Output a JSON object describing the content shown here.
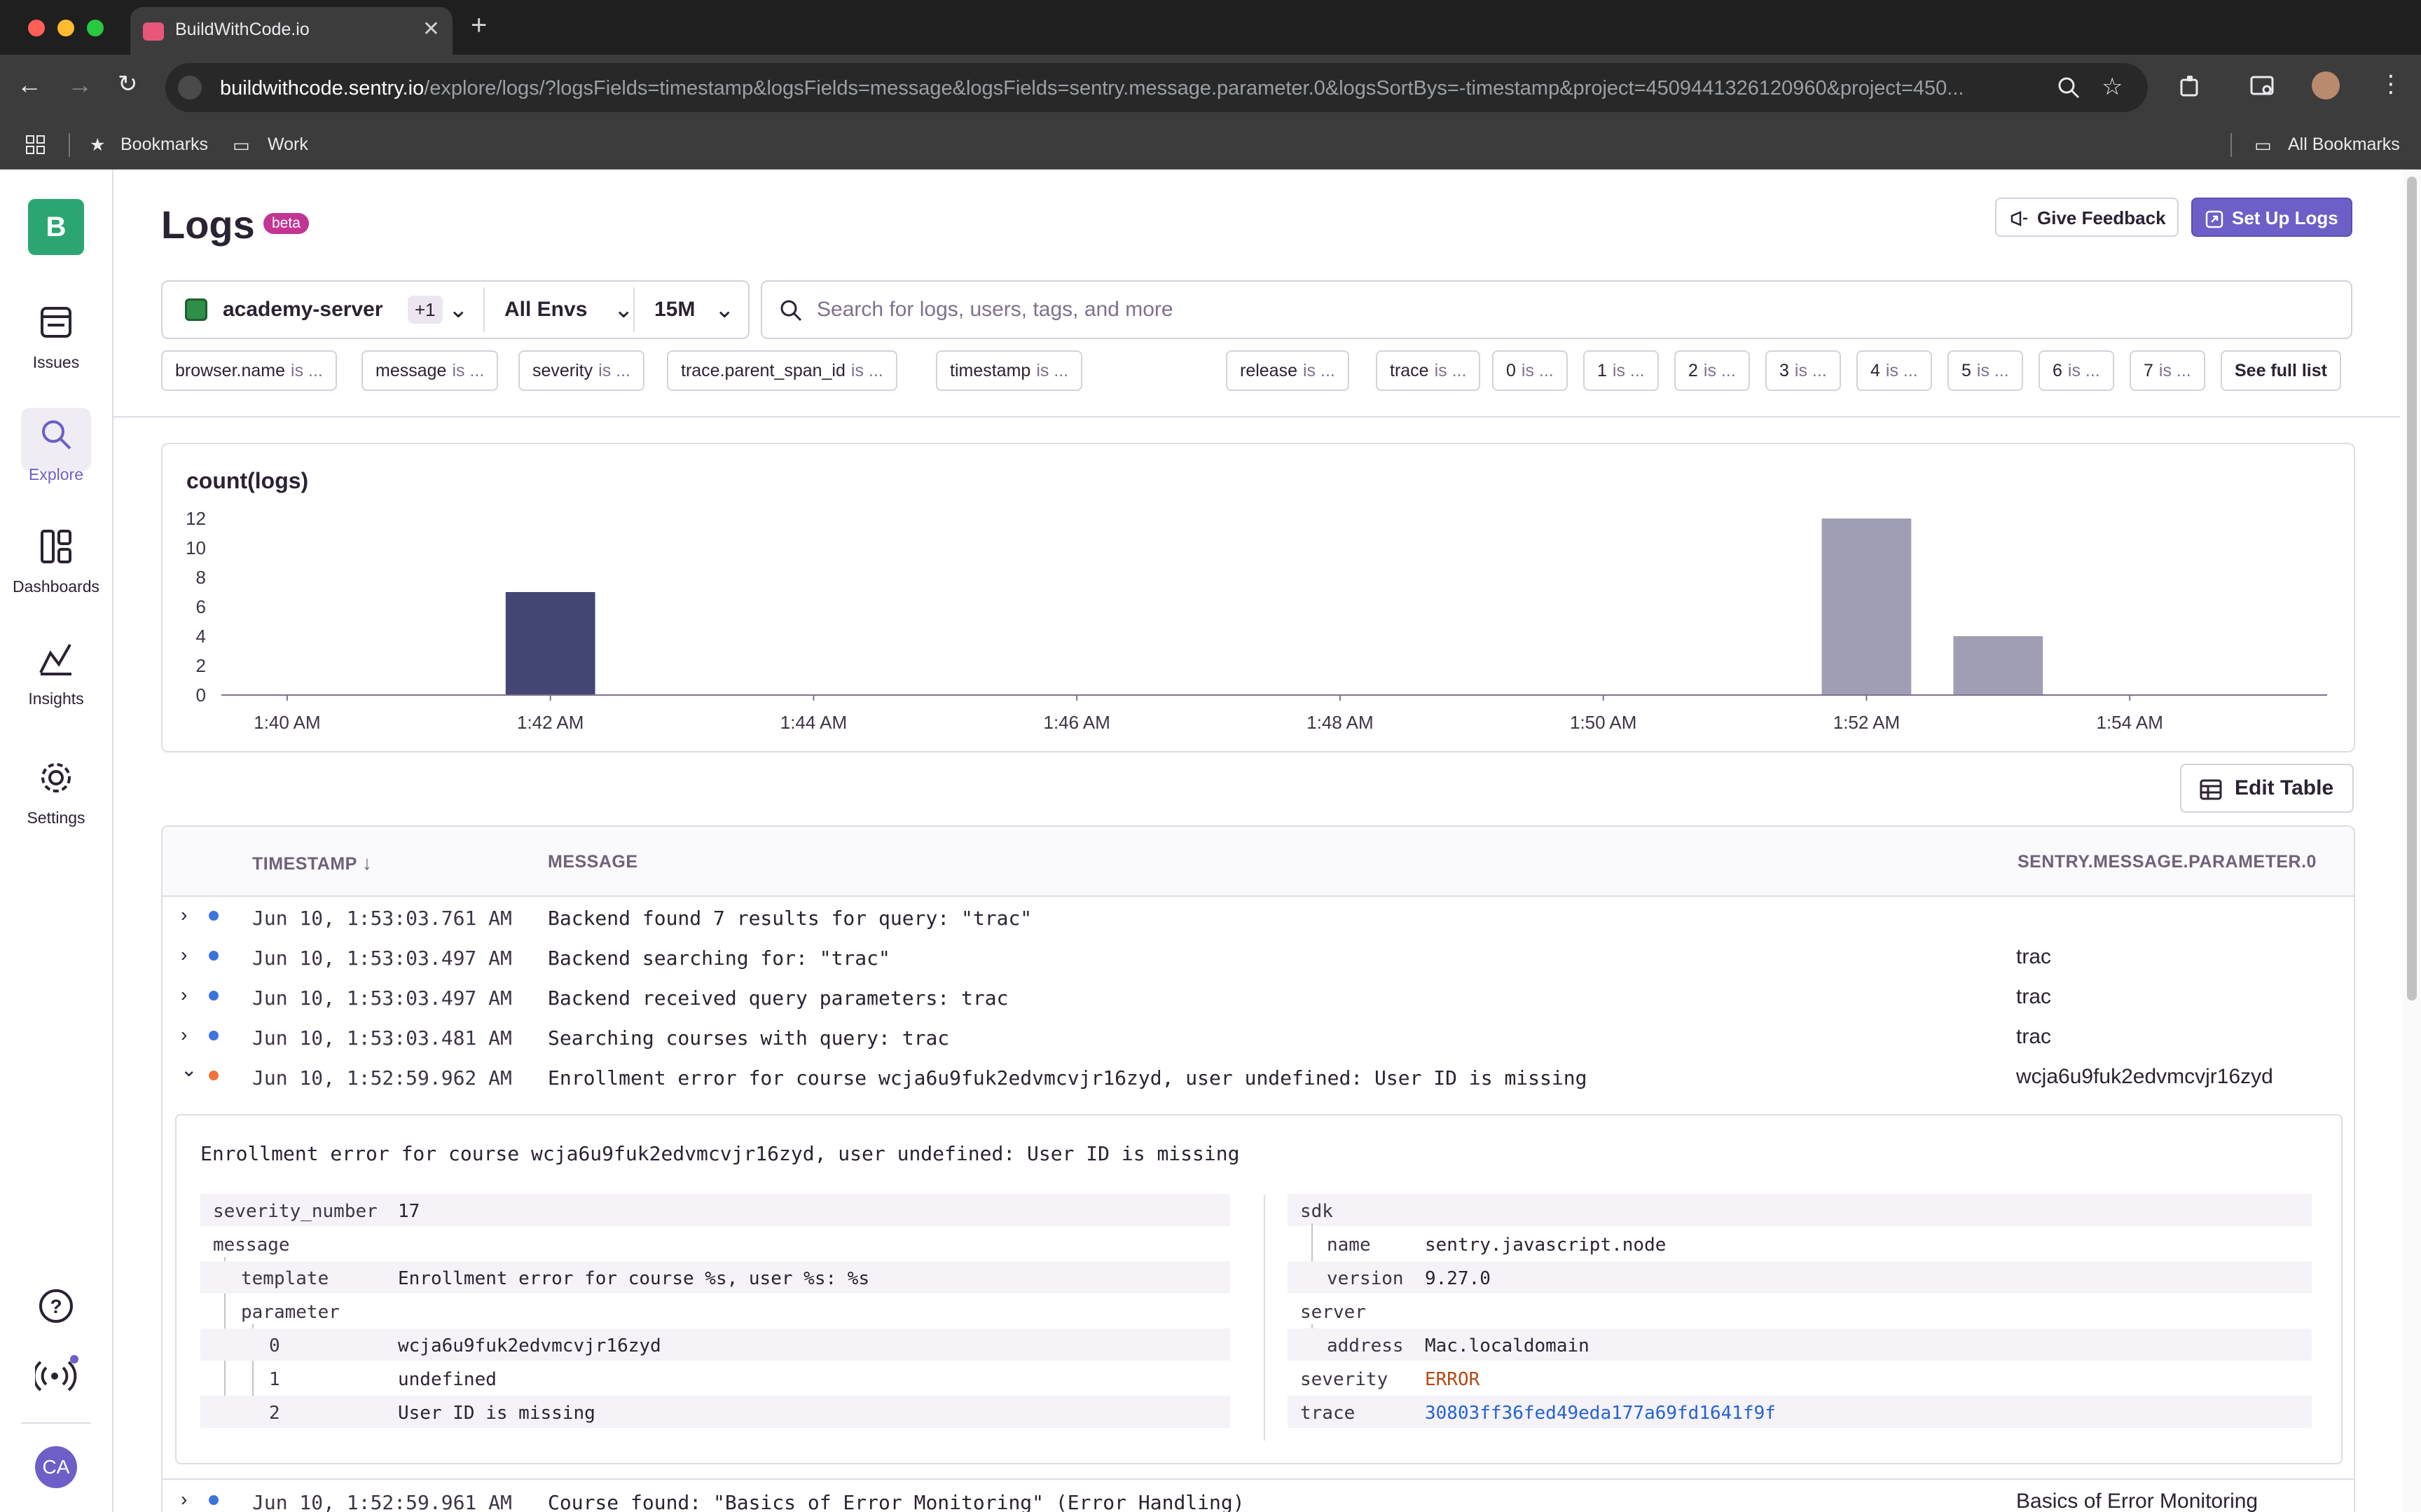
{
  "browser": {
    "tab_title": "BuildWithCode.io",
    "tab_close": "✕",
    "new_tab": "+",
    "url_host": "buildwithcode.sentry.io",
    "url_path": "/explore/logs/?logsFields=timestamp&logsFields=message&logsFields=sentry.message.parameter.0&logsSortBys=-timestamp&project=4509441326120960&project=450...",
    "bookmarks": {
      "bookmarks_label": "Bookmarks",
      "work_label": "Work",
      "all_bookmarks_label": "All Bookmarks"
    }
  },
  "sidebar": {
    "org_initial": "B",
    "items": [
      {
        "label": "Issues"
      },
      {
        "label": "Explore"
      },
      {
        "label": "Dashboards"
      },
      {
        "label": "Insights"
      },
      {
        "label": "Settings"
      }
    ],
    "avatar_initials": "CA",
    "help_glyph": "?"
  },
  "header": {
    "title": "Logs",
    "badge": "beta",
    "feedback_label": "Give Feedback",
    "setup_label": "Set Up Logs"
  },
  "filters": {
    "project": "academy-server",
    "project_extra": "+1",
    "environment": "All Envs",
    "period": "15M",
    "search_placeholder": "Search for logs, users, tags, and more"
  },
  "chips": [
    {
      "key": "browser.name",
      "op": "is ..."
    },
    {
      "key": "message",
      "op": "is ..."
    },
    {
      "key": "severity",
      "op": "is ..."
    },
    {
      "key": "trace.parent_span_id",
      "op": "is ..."
    },
    {
      "key": "timestamp",
      "op": "is ..."
    },
    {
      "key": "release",
      "op": "is ..."
    },
    {
      "key": "trace",
      "op": "is ..."
    },
    {
      "key": "0",
      "op": "is ..."
    },
    {
      "key": "1",
      "op": "is ..."
    },
    {
      "key": "2",
      "op": "is ..."
    },
    {
      "key": "3",
      "op": "is ..."
    },
    {
      "key": "4",
      "op": "is ..."
    },
    {
      "key": "5",
      "op": "is ..."
    },
    {
      "key": "6",
      "op": "is ..."
    },
    {
      "key": "7",
      "op": "is ..."
    }
  ],
  "see_full_list": "See full list",
  "chart_data": {
    "type": "bar",
    "title": "count(logs)",
    "ylim": [
      0,
      12
    ],
    "yticks": [
      0,
      2,
      4,
      6,
      8,
      10,
      12
    ],
    "xlim": [
      "1:39:30 AM",
      "1:55:30 AM"
    ],
    "xticks": [
      "1:40 AM",
      "1:42 AM",
      "1:44 AM",
      "1:46 AM",
      "1:48 AM",
      "1:50 AM",
      "1:52 AM",
      "1:54 AM"
    ],
    "bars": [
      {
        "x": "1:42 AM",
        "value": 7,
        "color": "#444674"
      },
      {
        "x": "1:52 AM",
        "value": 12,
        "color": "#a09eb4"
      },
      {
        "x": "1:53 AM",
        "value": 4,
        "color": "#a09eb4"
      }
    ],
    "grid": false,
    "legend": "none"
  },
  "edit_table_label": "Edit Table",
  "table": {
    "headers": {
      "timestamp": "TIMESTAMP",
      "sort_glyph": "↓",
      "message": "MESSAGE",
      "param": "SENTRY.MESSAGE.PARAMETER.0"
    },
    "rows_top": [
      {
        "ts": "Jun 10, 1:53:03.761 AM",
        "msg": "Backend found 7 results for query: \"trac\"",
        "param": "",
        "chev": "›"
      },
      {
        "ts": "Jun 10, 1:53:03.497 AM",
        "msg": "Backend searching for: \"trac\"",
        "param": "trac",
        "chev": "›"
      },
      {
        "ts": "Jun 10, 1:53:03.497 AM",
        "msg": "Backend received query parameters: trac",
        "param": "trac",
        "chev": "›"
      },
      {
        "ts": "Jun 10, 1:53:03.481 AM",
        "msg": "Searching courses with query: trac",
        "param": "trac",
        "chev": "›"
      }
    ],
    "expanded_row": {
      "ts": "Jun 10, 1:52:59.962 AM",
      "msg": "Enrollment error for course wcja6u9fuk2edvmcvjr16zyd, user undefined: User ID is missing",
      "param": "wcja6u9fuk2edvmcvjr16zyd",
      "chev": "⌄"
    },
    "last_row": {
      "ts": "Jun 10, 1:52:59.961 AM",
      "msg": "Course found: \"Basics of Error Monitoring\" (Error Handling)",
      "param": "Basics of Error Monitoring",
      "chev": "›"
    }
  },
  "detail": {
    "message": "Enrollment error for course wcja6u9fuk2edvmcvjr16zyd, user undefined: User ID is missing",
    "left": {
      "severity_number_k": "severity_number",
      "severity_number_v": "17",
      "message_k": "message",
      "template_k": "template",
      "template_v": "Enrollment error for course %s, user %s: %s",
      "parameter_k": "parameter",
      "p0_k": "0",
      "p0_v": "wcja6u9fuk2edvmcvjr16zyd",
      "p1_k": "1",
      "p1_v": "undefined",
      "p2_k": "2",
      "p2_v": "User ID is missing"
    },
    "right": {
      "sdk_k": "sdk",
      "name_k": "name",
      "name_v": "sentry.javascript.node",
      "version_k": "version",
      "version_v": "9.27.0",
      "server_k": "server",
      "address_k": "address",
      "address_v": "Mac.localdomain",
      "severity_k": "severity",
      "severity_v": "ERROR",
      "trace_k": "trace",
      "trace_v": "30803ff36fed49eda177a69fd1641f9f"
    }
  }
}
